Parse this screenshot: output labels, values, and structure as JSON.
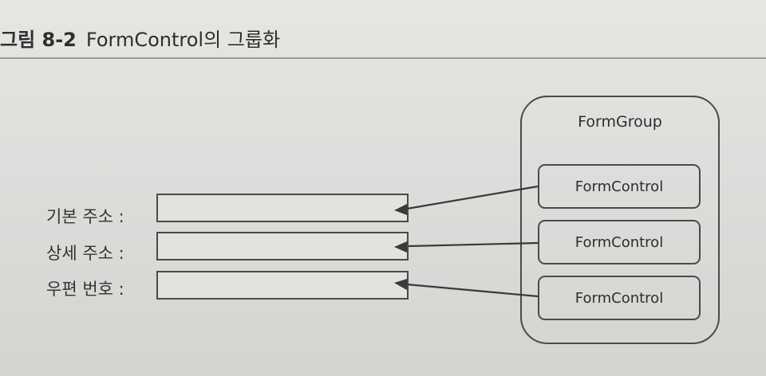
{
  "caption": {
    "figure_number": "그림 8-2",
    "title": "FormControl의 그룹화"
  },
  "form_fields": [
    {
      "label": "기본 주소 :"
    },
    {
      "label": "상세 주소 :"
    },
    {
      "label": "우편 번호 :"
    }
  ],
  "form_group": {
    "title": "FormGroup",
    "controls": [
      "FormControl",
      "FormControl",
      "FormControl"
    ]
  }
}
